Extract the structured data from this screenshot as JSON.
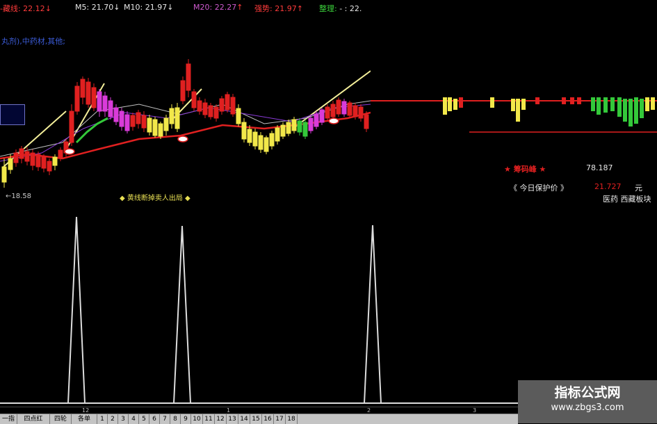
{
  "ma_bar": {
    "items": [
      {
        "label": "-藏线:",
        "value": "22.12",
        "arrow": "↓",
        "label_color": "#ff3b3b",
        "value_color": "#ff3b3b",
        "arrow_color": "#ff3b3b"
      },
      {
        "label": "M5:",
        "value": "21.70",
        "arrow": "↓",
        "label_color": "#e8e8e8",
        "value_color": "#e8e8e8",
        "arrow_color": "#e8e8e8"
      },
      {
        "label": "M10:",
        "value": "21.97",
        "arrow": "↓",
        "label_color": "#e8e8e8",
        "value_color": "#e8e8e8",
        "arrow_color": "#e8e8e8"
      },
      {
        "label": "M20:",
        "value": "22.27",
        "arrow": "↑",
        "label_color": "#d05bd0",
        "value_color": "#d05bd0",
        "arrow_color": "#ff3b3b"
      },
      {
        "label": "强势:",
        "value": "21.97",
        "arrow": "↑",
        "label_color": "#ff3b3b",
        "value_color": "#ff3b3b",
        "arrow_color": "#ff3b3b"
      },
      {
        "label": "整理:",
        "value": "- : 22.",
        "arrow": "",
        "label_color": "#3bd23b",
        "value_color": "#e8e8e8",
        "arrow_color": "#e8e8e8"
      }
    ]
  },
  "info_line": "丸剂),中药材,其他;",
  "low_label": "←18.58",
  "signal_label": "◆ 黄线断掉卖人出局 ◆",
  "right_panel": {
    "chip_label": "★ 筹码峰 ★",
    "chip_value": "78.187",
    "protect_label": "《 今日保护价 》",
    "protect_value": "21.727",
    "protect_unit": "元",
    "sector": "医药 西藏板块"
  },
  "axis_labels": [
    "12",
    "1",
    "2",
    "3"
  ],
  "tabs": [
    "一指标",
    "四点红",
    "四轮",
    "各单",
    "1",
    "2",
    "3",
    "4",
    "5",
    "6",
    "7",
    "8",
    "9",
    "10",
    "11",
    "12",
    "13",
    "14",
    "15",
    "16",
    "17",
    "18"
  ],
  "watermark": {
    "title": "指标公式网",
    "url": "www.zbgs3.com"
  },
  "colors": {
    "up": "#e02020",
    "down_yellow": "#f2e84a",
    "magenta": "#d93bd9",
    "green": "#34c83a",
    "ma_red": "#e02020",
    "trend_yellow": "#f4ef9a"
  }
}
